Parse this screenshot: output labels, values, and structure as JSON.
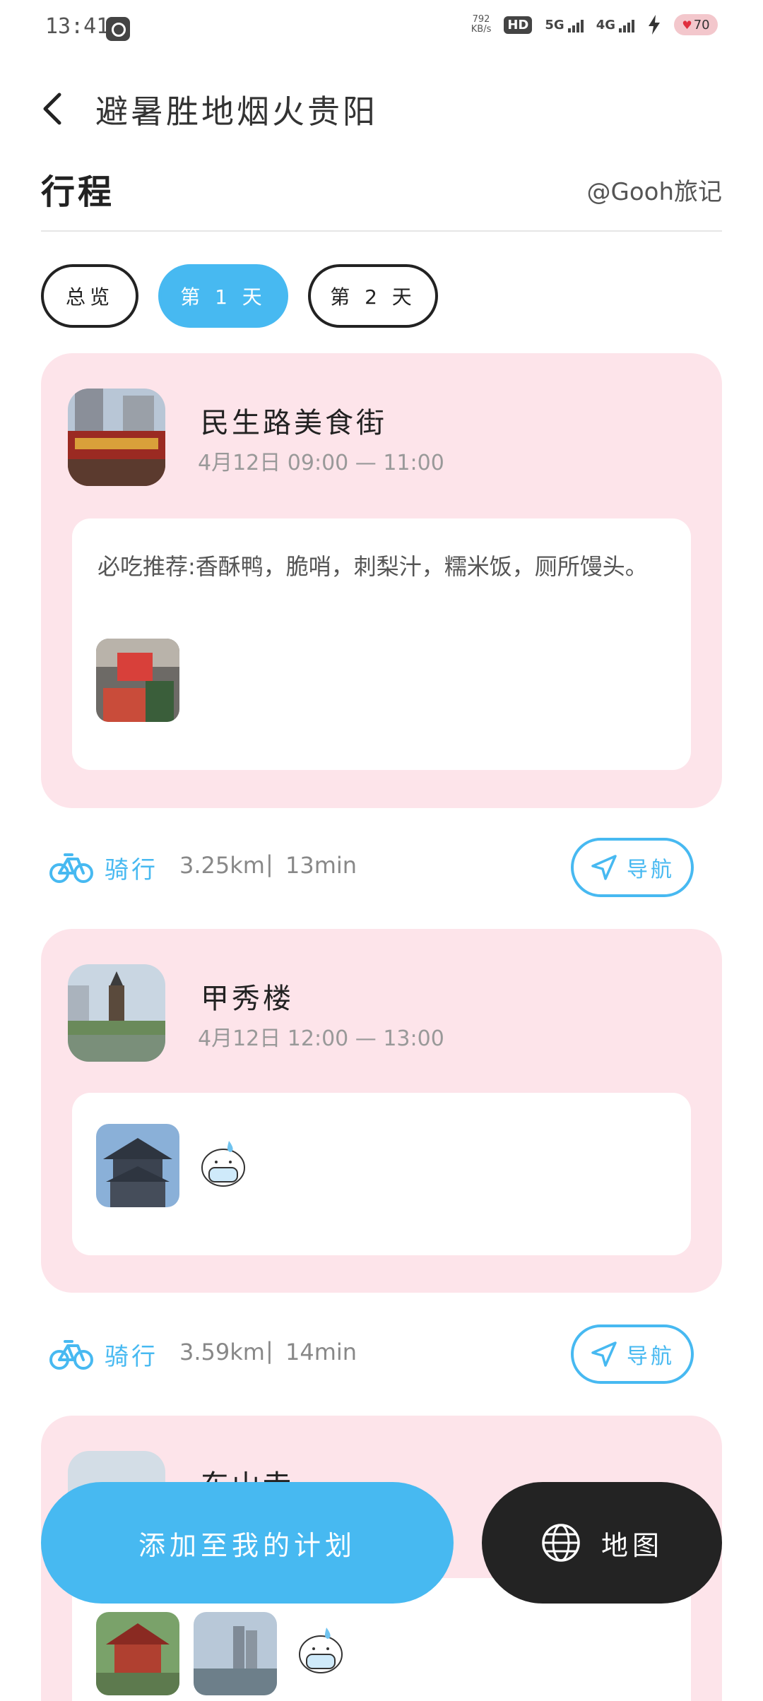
{
  "status_bar": {
    "time": "13:41",
    "net_speed_value": "792",
    "net_speed_unit": "KB/s",
    "hd_label": "HD",
    "signal_1": "5G",
    "signal_2": "4G",
    "battery": "70"
  },
  "header": {
    "title": "避暑胜地烟火贵阳"
  },
  "section": {
    "title": "行程",
    "author": "@Gooh旅记"
  },
  "tabs": [
    {
      "label": "总览"
    },
    {
      "label": "第 1 天"
    },
    {
      "label": "第 2 天"
    }
  ],
  "stops": [
    {
      "name": "民生路美食街",
      "time": "4月12日 09:00 — 11:00",
      "note": "必吃推荐:香酥鸭，脆哨，刺梨汁，糯米饭，厕所馒头。"
    },
    {
      "name": "甲秀楼",
      "time": "4月12日 12:00 — 13:00",
      "note": ""
    },
    {
      "name": "东山寺",
      "time": "",
      "note": ""
    }
  ],
  "routes": [
    {
      "mode": "骑行",
      "distance": "3.25km",
      "duration": "13min",
      "nav_label": "导航"
    },
    {
      "mode": "骑行",
      "distance": "3.59km",
      "duration": "14min",
      "nav_label": "导航"
    }
  ],
  "separator": "|",
  "bottom": {
    "add_plan_label": "添加至我的计划",
    "map_label": "地图"
  },
  "colors": {
    "accent": "#47b9f1",
    "card_bg": "#fde4ea",
    "dark": "#232323"
  },
  "icons": [
    "back-arrow-icon",
    "bike-icon",
    "navigate-icon",
    "globe-icon"
  ]
}
